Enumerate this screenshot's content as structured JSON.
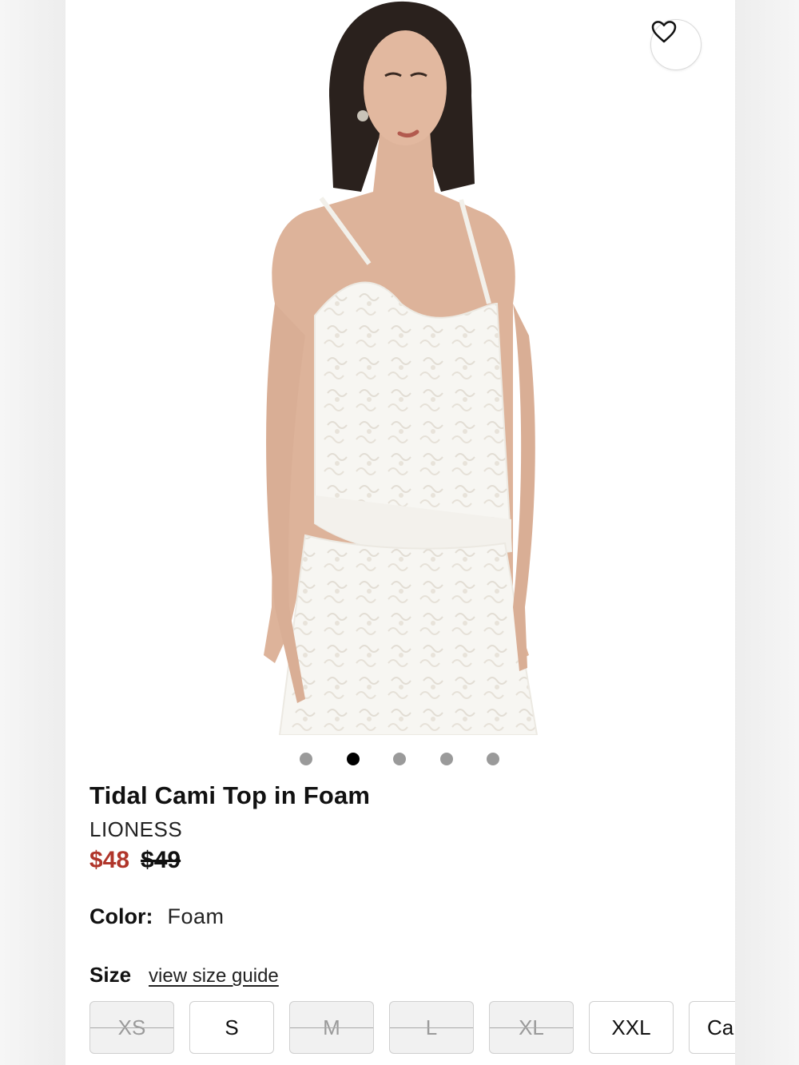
{
  "product": {
    "title": "Tidal Cami Top in Foam",
    "brand": "LIONESS",
    "price_sale": "$48",
    "price_original": "$49"
  },
  "gallery": {
    "total_images": 5,
    "active_index": 2
  },
  "wishlist": {
    "icon": "heart-outline-icon"
  },
  "color": {
    "label": "Color:",
    "value": "Foam"
  },
  "size": {
    "label": "Size",
    "guide_link": "view size guide",
    "options": [
      {
        "label": "XS",
        "available": false
      },
      {
        "label": "S",
        "available": true
      },
      {
        "label": "M",
        "available": false
      },
      {
        "label": "L",
        "available": false
      },
      {
        "label": "XL",
        "available": false
      },
      {
        "label": "XXL",
        "available": true
      },
      {
        "label": "Ca",
        "available": true
      }
    ]
  },
  "colors": {
    "sale_price": "#b0352a",
    "active_dot": "#000000",
    "inactive_dot": "#9a9a9a"
  }
}
